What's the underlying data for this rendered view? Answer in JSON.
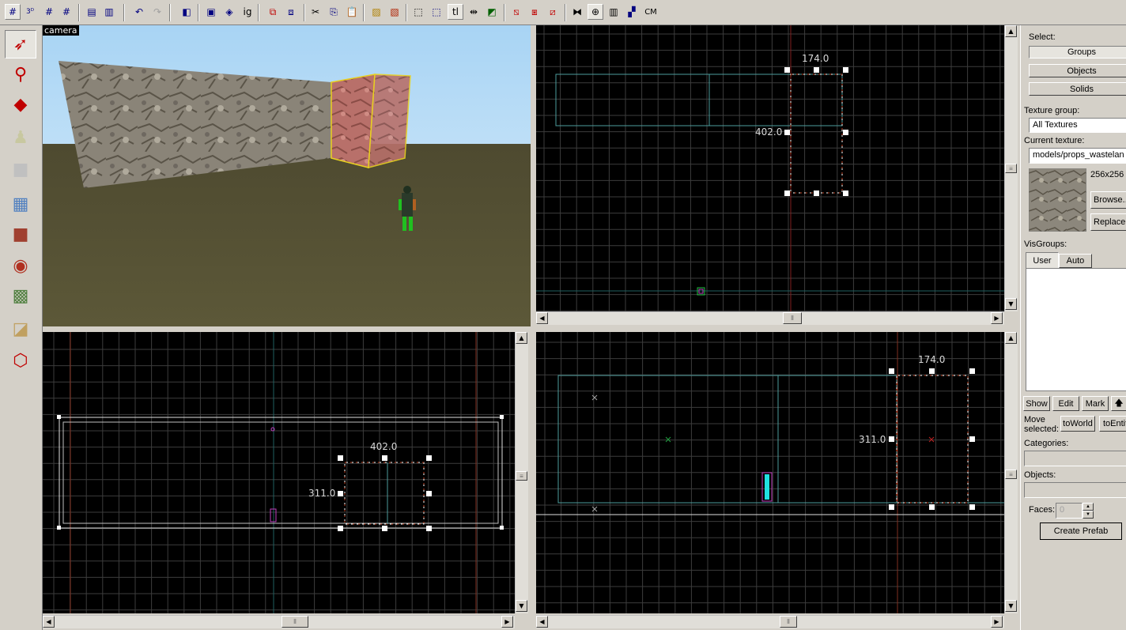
{
  "toolbar": {
    "buttons": [
      "grid-icon",
      "3d-grid-icon",
      "smaller-grid-icon",
      "larger-grid-icon",
      "group-icon",
      "ungroup-icon",
      "undo-icon",
      "redo-icon",
      "carve-icon",
      "hide-icon",
      "show-icon",
      "ignore-group-icon",
      "tie-icon",
      "to-world-icon",
      "cut-icon",
      "copy-icon",
      "paste-icon",
      "texture-lock-icon",
      "texture-scale-lock-icon",
      "selection-box-icon",
      "auto-select-icon",
      "tl-icon",
      "flip-icon",
      "clip-icon",
      "2d-view-icon",
      "3d-view-icon",
      "3d-ray-icon",
      "compile-icon",
      "run-icon",
      "entity-report-icon",
      "check-problems-icon",
      "cm-icon"
    ],
    "ignore_group_label": "ig",
    "tl_label": "tl",
    "cm_label": "CM"
  },
  "left_tools": [
    "selection-tool-icon",
    "magnify-tool-icon",
    "camera-tool-icon",
    "entity-tool-icon",
    "block-tool-icon",
    "texture-application-icon",
    "apply-current-texture-icon",
    "decal-tool-icon",
    "overlay-tool-icon",
    "clipping-tool-icon",
    "vertex-tool-icon"
  ],
  "viewports": {
    "camera": {
      "label": "camera"
    },
    "top": {
      "width_label": "174.0",
      "height_label": "402.0"
    },
    "front": {
      "width_label": "402.0",
      "height_label": "311.0"
    },
    "side": {
      "width_label": "174.0",
      "height_label": "311.0"
    }
  },
  "right_panel": {
    "select_label": "Select:",
    "groups_button": "Groups",
    "objects_button": "Objects",
    "solids_button": "Solids",
    "texture_group_label": "Texture group:",
    "texture_group_value": "All Textures",
    "current_texture_label": "Current texture:",
    "current_texture_value": "models/props_wastelan",
    "texture_size": "256x256",
    "browse_button": "Browse...",
    "replace_button": "Replace...",
    "visgroups_label": "VisGroups:",
    "tab_user": "User",
    "tab_auto": "Auto",
    "show_button": "Show",
    "edit_button": "Edit",
    "mark_button": "Mark",
    "move_selected_label": "Move selected:",
    "to_world_button": "toWorld",
    "to_entity_button": "toEntity",
    "categories_label": "Categories:",
    "objects_label": "Objects:",
    "faces_label": "Faces:",
    "faces_value": "0",
    "create_prefab_button": "Create Prefab"
  }
}
